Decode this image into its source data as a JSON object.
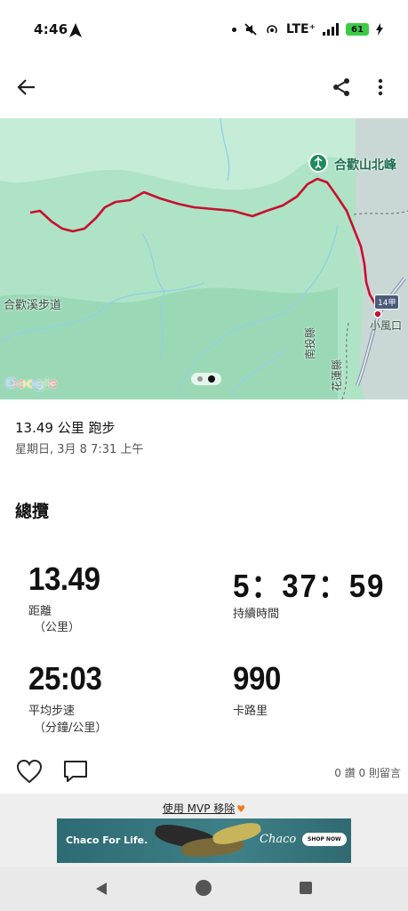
{
  "status_bar": {
    "time": "4:46",
    "network": "LTE⁺",
    "battery": "61"
  },
  "map": {
    "peak_label": "合歡山北峰",
    "trail_label": "合歡溪步道",
    "town_label": "小風口",
    "road_badge": "14甲",
    "county_1": "南投縣",
    "county_2": "花蓮縣",
    "attribution": "Google",
    "route_color": "#c8102e"
  },
  "activity": {
    "title": "13.49 公里 跑步",
    "date": "星期日, 3月 8 7:31 上午"
  },
  "summary": {
    "title": "總攬",
    "distance": {
      "value": "13.49",
      "label": "距離",
      "unit": "（公里）"
    },
    "duration": {
      "value": "5：37：59",
      "label": "持續時間"
    },
    "pace": {
      "value": "25:03",
      "label": "平均步速",
      "unit": "（分鐘/公里）"
    },
    "calories": {
      "value": "990",
      "label": "卡路里"
    }
  },
  "social": {
    "counts": "0 讚 0 則留言"
  },
  "ad": {
    "remove_text": "使用 MVP 移除",
    "headline": "Chaco For Life.",
    "brand": "Chaco",
    "cta": "SHOP NOW"
  }
}
